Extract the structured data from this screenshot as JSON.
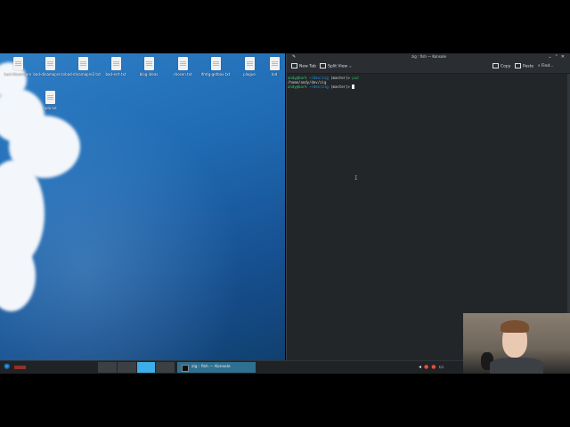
{
  "desktop": {
    "icons": [
      {
        "label": "bad-dinamapre"
      },
      {
        "label": "bad-dinamapre.txt"
      },
      {
        "label": "bad-dinamapre2.txt"
      },
      {
        "label": "bad-errt.txt"
      },
      {
        "label": "blog-ideas"
      },
      {
        "label": "chosen.txt"
      },
      {
        "label": "lfmtg-getbox.txt"
      },
      {
        "label": "plague"
      },
      {
        "label": "tod"
      },
      {
        "label": "todo.txt"
      }
    ]
  },
  "konsole": {
    "title": "zig : fish — Konsole",
    "toolbar": {
      "new_tab": "New Tab",
      "split_view": "Split View",
      "copy": "Copy",
      "paste": "Paste",
      "find": "Find..."
    },
    "lines": [
      {
        "user": "andy@bark",
        "path": "~/dev/zig",
        "branch": " (master)> ",
        "cmd": "pwd"
      },
      {
        "output": "/home/andy/dev/zig"
      },
      {
        "user": "andy@bark",
        "path": "~/dev/zig",
        "branch": " (master)> ",
        "cmd": ""
      }
    ]
  },
  "taskbar": {
    "task_label": "zig : fish — Konsole",
    "pager_active": 3
  },
  "colors": {
    "terminal_bg": "#232629",
    "accent": "#3daee9",
    "prompt_user": "#2ecc71",
    "prompt_path": "#1d99f3"
  }
}
